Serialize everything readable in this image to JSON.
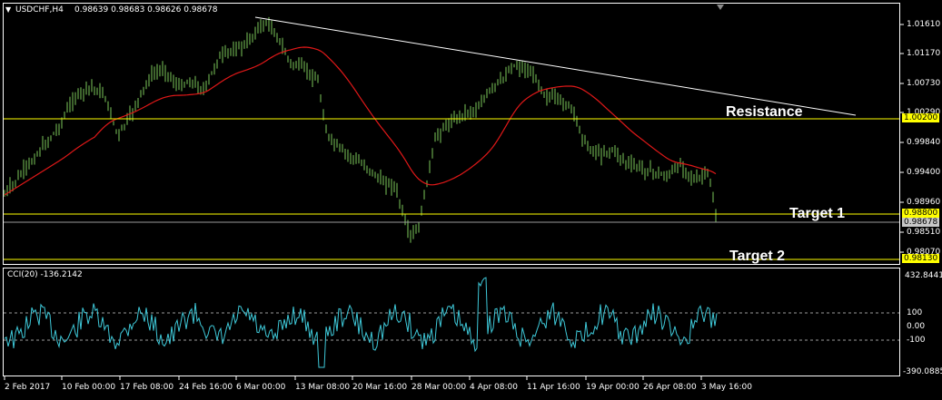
{
  "header": {
    "symbol_label": "USDCHF,H4",
    "ohlc": "0.98639 0.98683 0.98626 0.98678",
    "dropdown_glyph": "▼"
  },
  "indicator": {
    "label": "CCI(20) -136.2142"
  },
  "price_axis": {
    "ticks": [
      "1.01610",
      "1.01170",
      "1.00730",
      "1.00290",
      "0.99840",
      "0.99400",
      "0.98960",
      "0.98510",
      "0.98070"
    ],
    "highlighted": [
      {
        "value": "1.00200",
        "color": "#ffff00"
      },
      {
        "value": "0.98800",
        "color": "#ffff00"
      },
      {
        "value": "0.98678",
        "color": "#c8c8c8"
      },
      {
        "value": "0.98130",
        "color": "#ffff00"
      }
    ]
  },
  "cci_axis": {
    "ticks": [
      "432.8441",
      "100",
      "0.00",
      "-100",
      "-390.0885"
    ]
  },
  "time_axis": {
    "labels": [
      "2 Feb 2017",
      "10 Feb 00:00",
      "17 Feb 08:00",
      "24 Feb 16:00",
      "6 Mar 00:00",
      "13 Mar 08:00",
      "20 Mar 16:00",
      "28 Mar 00:00",
      "4 Apr 08:00",
      "11 Apr 16:00",
      "19 Apr 00:00",
      "26 Apr 08:00",
      "3 May 16:00"
    ]
  },
  "annotations": {
    "resistance": "Resistance",
    "target1": "Target 1",
    "target2": "Target 2"
  },
  "colors": {
    "background": "#000000",
    "candles": "#7cc95a",
    "moving_average": "#e01818",
    "level_lines": "#ffff00",
    "trendline": "#ffffff",
    "cci_line": "#3ec8d8",
    "axis": "#ffffff"
  }
}
